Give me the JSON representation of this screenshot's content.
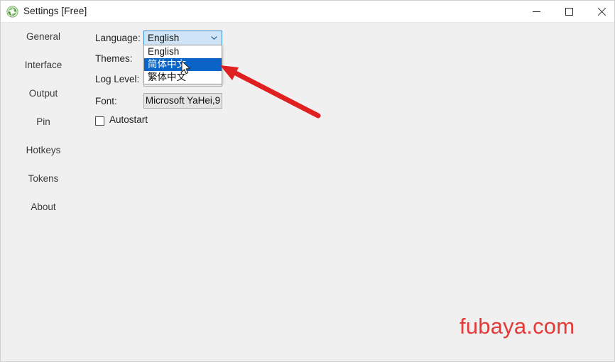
{
  "window": {
    "title": "Settings [Free]",
    "icon": "app-spiral-icon",
    "controls": {
      "minimize": "minimize",
      "maximize": "maximize",
      "close": "close"
    }
  },
  "sidebar": {
    "items": [
      {
        "label": "General"
      },
      {
        "label": "Interface"
      },
      {
        "label": "Output"
      },
      {
        "label": "Pin"
      },
      {
        "label": "Hotkeys"
      },
      {
        "label": "Tokens"
      },
      {
        "label": "About"
      }
    ]
  },
  "form": {
    "rows": [
      {
        "label": "Language:",
        "value": "English"
      },
      {
        "label": "Themes:",
        "value": ""
      },
      {
        "label": "Log Level:",
        "value": ""
      },
      {
        "label": "Font:",
        "value": "Microsoft YaHei,9"
      }
    ],
    "language_label": "Language:",
    "language_value": "English",
    "themes_label": "Themes:",
    "themes_value": "",
    "log_level_label": "Log Level:",
    "log_level_value": "",
    "font_label": "Font:",
    "font_value": "Microsoft YaHei,9",
    "autostart_label": "Autostart",
    "autostart_checked": false
  },
  "dropdown": {
    "open": true,
    "selected_index": 1,
    "options": [
      {
        "label": "English"
      },
      {
        "label": "简体中文"
      },
      {
        "label": "繁体中文"
      }
    ]
  },
  "annotation": {
    "arrow": "red-arrow-pointing-to-dropdown"
  },
  "watermark": {
    "text": "fubaya.com"
  },
  "colors": {
    "background": "#f0f0f0",
    "titlebar": "#ffffff",
    "highlight": "#0a64c8",
    "combo_fill": "#cfe5f7",
    "combo_border": "#3a8ad0",
    "annotation_red": "#e02020",
    "watermark_red": "#e23b38",
    "icon_green": "#5aa84f"
  }
}
